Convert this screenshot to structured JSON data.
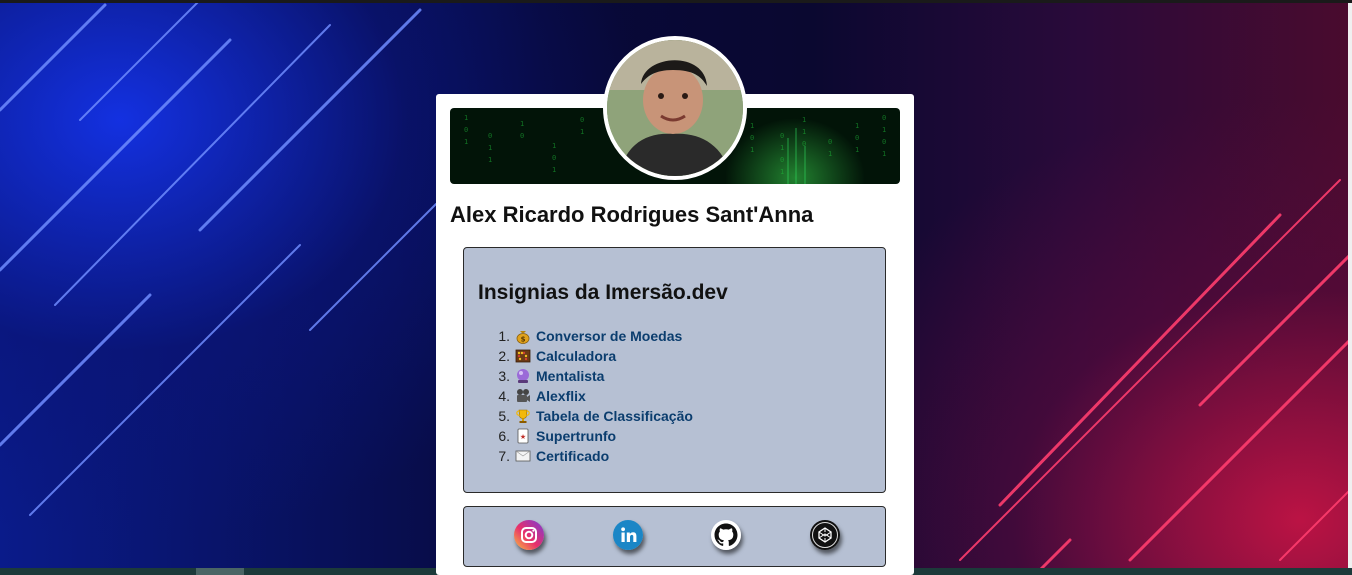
{
  "profile": {
    "name": "Alex Ricardo Rodrigues Sant'Anna"
  },
  "badges": {
    "title": "Insignias da Imersão.dev",
    "items": [
      {
        "num": "1.",
        "icon": "money-bag-icon",
        "label": "Conversor de Moedas"
      },
      {
        "num": "2.",
        "icon": "abacus-icon",
        "label": "Calculadora"
      },
      {
        "num": "3.",
        "icon": "crystal-ball-icon",
        "label": "Mentalista"
      },
      {
        "num": "4.",
        "icon": "cinema-icon",
        "label": "Alexflix"
      },
      {
        "num": "5.",
        "icon": "trophy-icon",
        "label": "Tabela de Classificação"
      },
      {
        "num": "6.",
        "icon": "playing-card-icon",
        "label": "Supertrunfo"
      },
      {
        "num": "7.",
        "icon": "certificate-icon",
        "label": "Certificado"
      }
    ]
  },
  "social": [
    {
      "name": "instagram-icon"
    },
    {
      "name": "linkedin-icon"
    },
    {
      "name": "github-icon"
    },
    {
      "name": "codepen-icon"
    }
  ],
  "colors": {
    "card": "#ffffff",
    "panel": "#b6c0d3",
    "link": "#0b3d6e"
  }
}
